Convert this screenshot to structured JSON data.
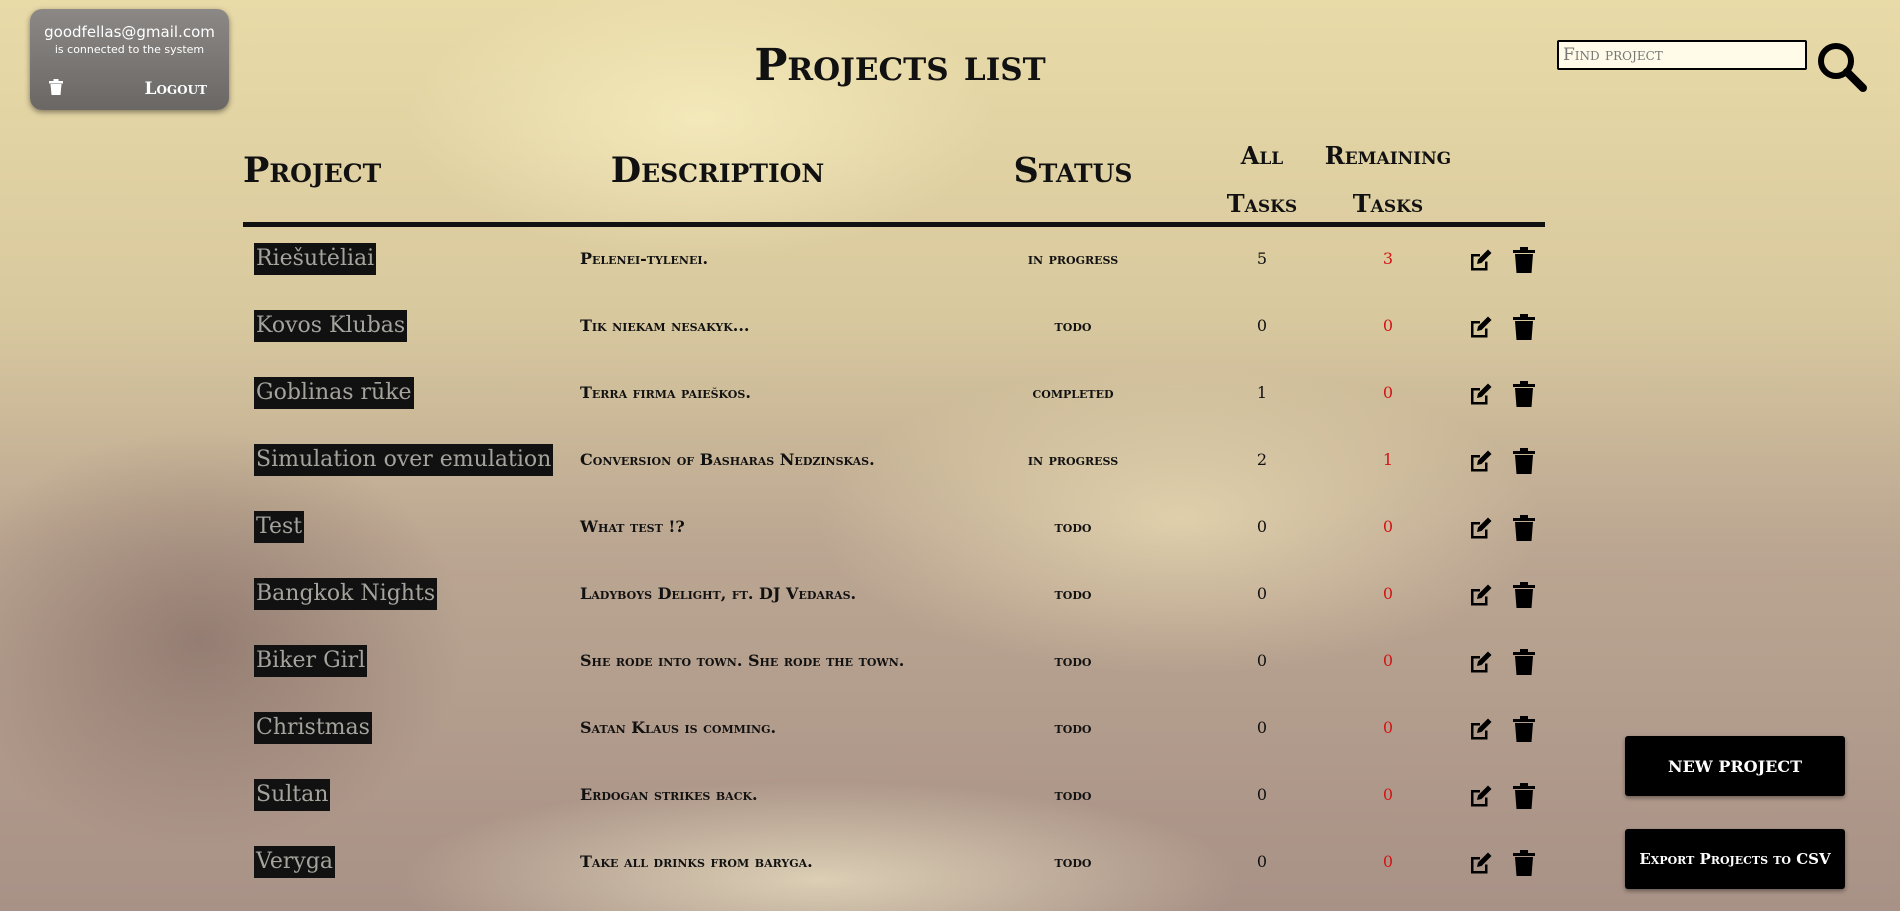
{
  "user": {
    "email": "goodfellas@gmail.com",
    "status": "is connected to the system",
    "trash_icon": "trash-icon",
    "logout_label": "Logout"
  },
  "page": {
    "title": "Projects list"
  },
  "search": {
    "placeholder": "Find project",
    "icon": "search-icon"
  },
  "table": {
    "headers": {
      "project": "Project",
      "description": "Description",
      "status": "Status",
      "all_tasks_line1": "All",
      "all_tasks_line2": "Tasks",
      "remaining_line1": "Remaining",
      "remaining_line2": "Tasks"
    },
    "rows": [
      {
        "name": "Riešutėliai",
        "description": "Pelenei-tylenei.",
        "status": "in progress",
        "all": "5",
        "remaining": "3"
      },
      {
        "name": "Kovos Klubas",
        "description": "Tik niekam nesakyk...",
        "status": "todo",
        "all": "0",
        "remaining": "0"
      },
      {
        "name": "Goblinas rūke",
        "description": "Terra firma paieškos.",
        "status": "completed",
        "all": "1",
        "remaining": "0"
      },
      {
        "name": "Simulation over emulation",
        "description": "Conversion of Basharas Nedzinskas.",
        "status": "in progress",
        "all": "2",
        "remaining": "1"
      },
      {
        "name": "Test",
        "description": "What test !?",
        "status": "todo",
        "all": "0",
        "remaining": "0"
      },
      {
        "name": "Bangkok Nights",
        "description": "Ladyboys Delight, ft. DJ Vedaras.",
        "status": "todo",
        "all": "0",
        "remaining": "0"
      },
      {
        "name": "Biker Girl",
        "description": "She rode into town. She rode the town.",
        "status": "todo",
        "all": "0",
        "remaining": "0"
      },
      {
        "name": "Christmas",
        "description": "Satan Klaus is comming.",
        "status": "todo",
        "all": "0",
        "remaining": "0"
      },
      {
        "name": "Sultan",
        "description": "Erdogan strikes back.",
        "status": "todo",
        "all": "0",
        "remaining": "0"
      },
      {
        "name": "Veryga",
        "description": "Take all drinks from baryga.",
        "status": "todo",
        "all": "0",
        "remaining": "0"
      }
    ]
  },
  "actions": {
    "new_project": "NEW PROJECT",
    "export_csv": "Export Projects to CSV"
  },
  "colors": {
    "remaining_tasks": "#d21515",
    "name_bg": "#111111",
    "name_text": "#a4a39c"
  }
}
